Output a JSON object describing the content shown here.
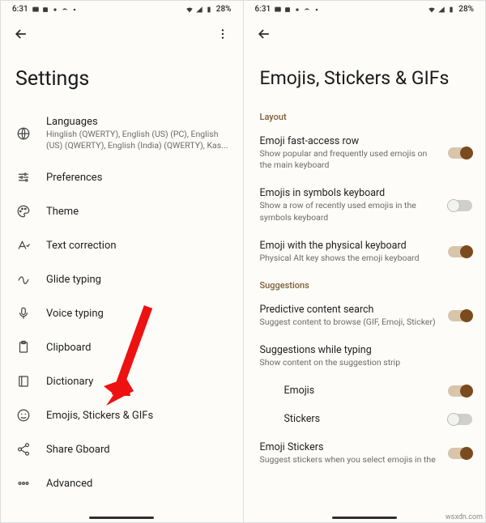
{
  "status": {
    "time": "6:31",
    "battery": "28%"
  },
  "left": {
    "title": "Settings",
    "items": [
      {
        "key": "languages",
        "label": "Languages",
        "sub": "Hinglish (QWERTY), English (US) (PC), English (US) (QWERTY), English (India) (QWERTY), Kas..."
      },
      {
        "key": "preferences",
        "label": "Preferences"
      },
      {
        "key": "theme",
        "label": "Theme"
      },
      {
        "key": "text-correction",
        "label": "Text correction"
      },
      {
        "key": "glide-typing",
        "label": "Glide typing"
      },
      {
        "key": "voice-typing",
        "label": "Voice typing"
      },
      {
        "key": "clipboard",
        "label": "Clipboard"
      },
      {
        "key": "dictionary",
        "label": "Dictionary"
      },
      {
        "key": "emojis",
        "label": "Emojis, Stickers & GIFs"
      },
      {
        "key": "share",
        "label": "Share Gboard"
      },
      {
        "key": "advanced",
        "label": "Advanced"
      }
    ]
  },
  "right": {
    "title": "Emojis, Stickers & GIFs",
    "sections": {
      "layout": "Layout",
      "suggestions": "Suggestions"
    },
    "rows": {
      "fast_access": {
        "title": "Emoji fast-access row",
        "sub": "Show popular and frequently used emojis on the main keyboard",
        "on": true
      },
      "symbols": {
        "title": "Emojis in symbols keyboard",
        "sub": "Show a row of recently used emojis in the symbols keyboard",
        "on": false
      },
      "physical": {
        "title": "Emoji with the physical keyboard",
        "sub": "Physical Alt key shows the emoji keyboard",
        "on": true
      },
      "predictive": {
        "title": "Predictive content search",
        "sub": "Suggest content to browse (GIF, Emoji, Sticker)",
        "on": true
      },
      "while_typing": {
        "title": "Suggestions while typing",
        "sub": "Show content on the suggestion strip"
      },
      "emojis": {
        "title": "Emojis",
        "on": true
      },
      "stickers": {
        "title": "Stickers",
        "on": false
      },
      "emoji_stickers": {
        "title": "Emoji Stickers",
        "sub": "Suggest stickers when you select emojis in the",
        "on": true
      }
    }
  },
  "watermark": "wsxdn.com"
}
